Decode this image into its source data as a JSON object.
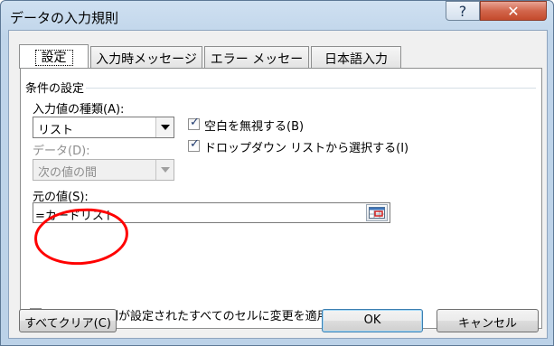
{
  "window": {
    "title": "データの入力規則"
  },
  "titlebar": {
    "help_glyph": "?",
    "close_glyph": "✕"
  },
  "tabs": [
    {
      "label": "設定",
      "active": true
    },
    {
      "label": "入力時メッセージ",
      "active": false
    },
    {
      "label": "エラー メッセージ",
      "active": false
    },
    {
      "label": "日本語入力",
      "active": false
    }
  ],
  "conditions": {
    "group_label": "条件の設定",
    "allow_label": "入力値の種類(A):",
    "allow_value": "リスト",
    "data_label": "データ(D):",
    "data_value": "次の値の間",
    "ignore_blank": {
      "label": "空白を無視する(B)",
      "checked": true
    },
    "in_cell_dropdown": {
      "label": "ドロップダウン リストから選択する(I)",
      "checked": true
    },
    "source_label": "元の値(S):",
    "source_value": "=カードリスト"
  },
  "apply_all": {
    "label": "同じ入力規則が設定されたすべてのセルに変更を適用する(P)",
    "checked": false
  },
  "buttons": {
    "clear_all": "すべてクリア(C)",
    "ok": "OK",
    "cancel": "キャンセル"
  },
  "colors": {
    "annotation_circle": "#ff0000",
    "close_button": "#c44a2c",
    "frame": "#bcd2e8"
  }
}
